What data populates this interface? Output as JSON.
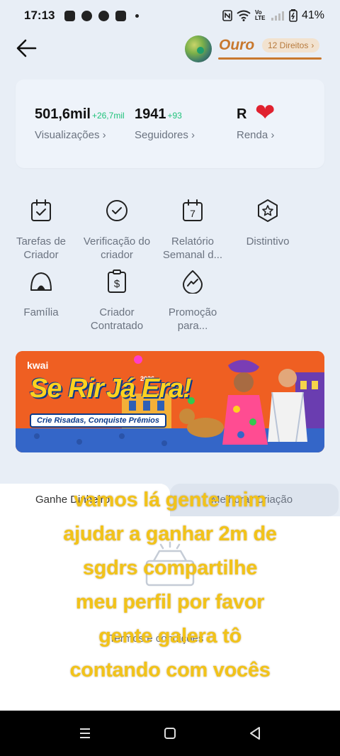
{
  "status": {
    "time": "17:13",
    "battery": "41%",
    "network": "Vo LTE"
  },
  "header": {
    "level_title": "Ouro",
    "rights_badge": "12 Direitos"
  },
  "stats": [
    {
      "value": "501,6mil",
      "delta": "+26,7mil",
      "label": "Visualizações"
    },
    {
      "value": "1941",
      "delta": "+93",
      "label": "Seguidores"
    },
    {
      "value": "R",
      "delta": "",
      "label": "Renda"
    }
  ],
  "tools": [
    {
      "label": "Tarefas de Criador",
      "icon": "calendar-check-icon"
    },
    {
      "label": "Verificação do criador",
      "icon": "check-circle-icon"
    },
    {
      "label": "Relatório Semanal d...",
      "icon": "calendar-7-icon"
    },
    {
      "label": "Distintivo",
      "icon": "badge-star-icon"
    },
    {
      "label": "Família",
      "icon": "tent-icon"
    },
    {
      "label": "Criador Contratado",
      "icon": "dollar-clipboard-icon"
    },
    {
      "label": "Promoção para...",
      "icon": "trend-drop-icon"
    }
  ],
  "banner": {
    "logo": "kwai",
    "year": "2026",
    "title_line1": "Se Rir",
    "title_line2": "Já Era!",
    "subtitle": "Crie Risadas, Conquiste Prêmios"
  },
  "tabs": {
    "left": "Ganhe Dinheiro",
    "right": "Melhorar Criação"
  },
  "terms": "Termos e condições",
  "overlay_lines": [
    "vamos lá gente mim",
    "ajudar a ganhar 2m de",
    "sgdrs compartilhe",
    "meu perfil por favor",
    "gente galera tô",
    "contando com vocês"
  ],
  "colors": {
    "gold": "#c8782e",
    "delta_green": "#1fc27a",
    "overlay_yellow": "#f2c319",
    "banner_orange": "#ef5a22"
  }
}
